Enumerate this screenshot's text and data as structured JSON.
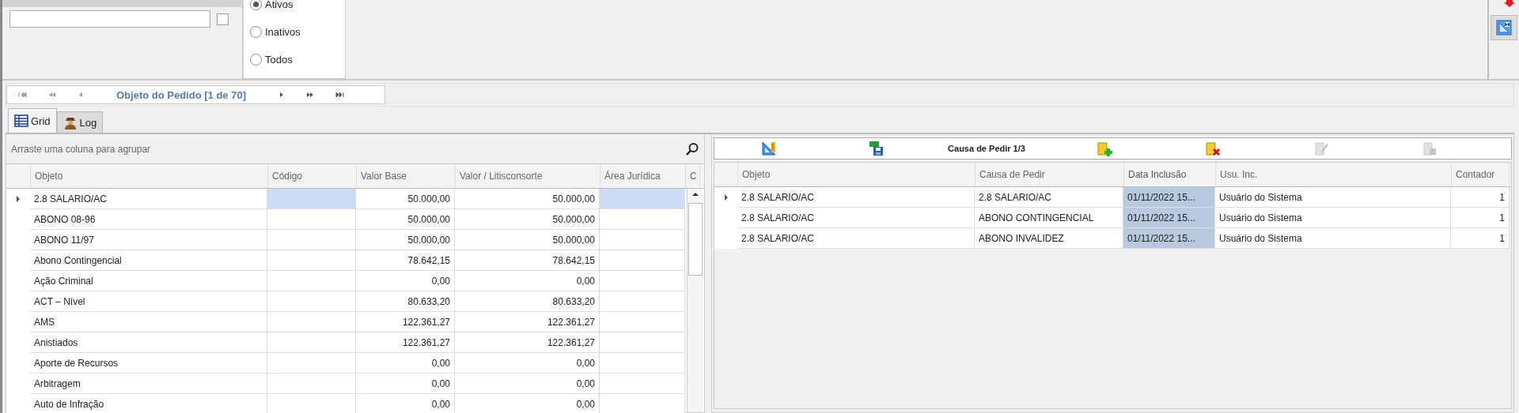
{
  "filter": {
    "checked": false
  },
  "status_filter": [
    {
      "label": "Ativos",
      "selected": true
    },
    {
      "label": "Inativos",
      "selected": false
    },
    {
      "label": "Todos",
      "selected": false
    }
  ],
  "navigator": {
    "title": "Objeto do Pedido [1 de 70]"
  },
  "tabs": [
    {
      "label": "Grid",
      "selected": true
    },
    {
      "label": "Log",
      "selected": false
    }
  ],
  "left_grid": {
    "group_hint": "Arraste uma coluna para agrupar",
    "columns": [
      "Objeto",
      "Código",
      "Valor Base",
      "Valor / Litisconsorte",
      "Área Jurídica",
      "C"
    ],
    "rows": [
      {
        "objeto": "2.8 SALARIO/AC",
        "valor_base": "50.000,00",
        "valor_litisconsorte": "50.000,00",
        "selected": true
      },
      {
        "objeto": "ABONO 08-96",
        "valor_base": "50.000,00",
        "valor_litisconsorte": "50.000,00",
        "selected": false
      },
      {
        "objeto": "ABONO 11/97",
        "valor_base": "50.000,00",
        "valor_litisconsorte": "50.000,00",
        "selected": false
      },
      {
        "objeto": "Abono Contingencial",
        "valor_base": "78.642,15",
        "valor_litisconsorte": "78.642,15",
        "selected": false
      },
      {
        "objeto": "Ação Criminal",
        "valor_base": "0,00",
        "valor_litisconsorte": "0,00",
        "selected": false
      },
      {
        "objeto": "ACT – Nível",
        "valor_base": "80.633,20",
        "valor_litisconsorte": "80.633,20",
        "selected": false
      },
      {
        "objeto": "AMS",
        "valor_base": "122.361,27",
        "valor_litisconsorte": "122.361,27",
        "selected": false
      },
      {
        "objeto": "Anistiados",
        "valor_base": "122.361,27",
        "valor_litisconsorte": "122.361,27",
        "selected": false
      },
      {
        "objeto": "Aporte de Recursos",
        "valor_base": "0,00",
        "valor_litisconsorte": "0,00",
        "selected": false
      },
      {
        "objeto": "Arbitragem",
        "valor_base": "0,00",
        "valor_litisconsorte": "0,00",
        "selected": false
      },
      {
        "objeto": "Auto de Infração",
        "valor_base": "0,00",
        "valor_litisconsorte": "0,00",
        "selected": false
      }
    ]
  },
  "right_grid": {
    "title": "Causa de Pedir 1/3",
    "tools_left": [
      {
        "kind": "layout",
        "disabled": false
      },
      {
        "kind": "excel",
        "disabled": false
      }
    ],
    "tools_right": [
      {
        "kind": "add",
        "disabled": false
      },
      {
        "kind": "delete",
        "disabled": false
      },
      {
        "kind": "edit",
        "disabled": true
      },
      {
        "kind": "print",
        "disabled": true
      }
    ],
    "columns": [
      {
        "label": "Objeto",
        "highlighted": false
      },
      {
        "label": "Causa de Pedir",
        "highlighted": false
      },
      {
        "label": "Data Inclusão",
        "highlighted": true
      },
      {
        "label": "Usu. Inc.",
        "highlighted": false
      },
      {
        "label": "Contador",
        "highlighted": false
      }
    ],
    "rows": [
      {
        "objeto": "2.8 SALARIO/AC",
        "causa": "2.8 SALARIO/AC",
        "data": "01/11/2022 15...",
        "usuario": "Usuário do Sistema",
        "contador": "1",
        "selected": true
      },
      {
        "objeto": "2.8 SALARIO/AC",
        "causa": "ABONO CONTINGENCIAL",
        "data": "01/11/2022 15...",
        "usuario": "Usuário do Sistema",
        "contador": "1",
        "selected": false
      },
      {
        "objeto": "2.8 SALARIO/AC",
        "causa": "ABONO INVALIDEZ",
        "data": "01/11/2022 15...",
        "usuario": "Usuário do Sistema",
        "contador": "1",
        "selected": false
      }
    ]
  }
}
